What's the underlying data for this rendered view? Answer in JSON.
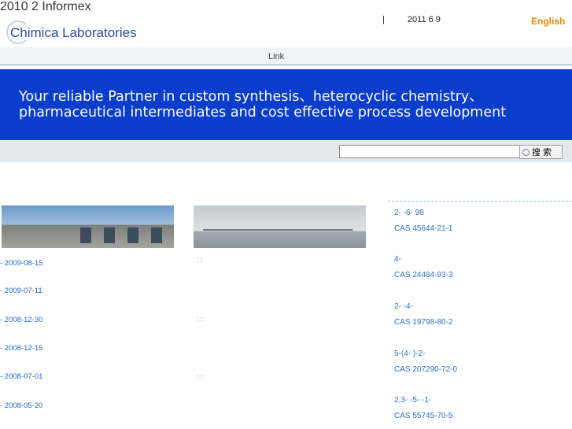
{
  "header": {
    "logo_text": "Chimica Laboratories",
    "separator": "|",
    "date": "2011 6 9",
    "language_link": "English"
  },
  "nav": {
    "link_label": "Link"
  },
  "banner": {
    "line1": "Your reliable Partner in custom synthesis、heterocyclic chemistry、",
    "line2": "pharmaceutical intermediates and cost effective process development"
  },
  "search": {
    "input_value": "",
    "button_label": "搜 索"
  },
  "news": {
    "items": [
      "- 2009-08-15",
      "- 2009-07-11",
      "- 2008-12-30",
      "- 2008-12-15",
      "- 2008-07-01",
      "- 2008-05-20"
    ],
    "subtext": "2010 2   Informex"
  },
  "middle": {
    "markers": [
      ": :",
      ": :",
      ": :"
    ]
  },
  "products": [
    {
      "name": "2-  -6-    98",
      "cas": "CAS 45644-21-1"
    },
    {
      "name": "4-",
      "cas": "CAS 24484-93-3"
    },
    {
      "name": "2-  -4-",
      "cas": "CAS 19798-80-2"
    },
    {
      "name": "5-(4-    )-2-",
      "cas": "CAS 207290-72-0"
    },
    {
      "name": "2,3-  -5-  -1-",
      "cas": "CAS 55745-70-5"
    }
  ],
  "colors": {
    "banner": "#0a3dcc",
    "link_blue": "#2167c8",
    "language_orange": "#e08a00"
  }
}
